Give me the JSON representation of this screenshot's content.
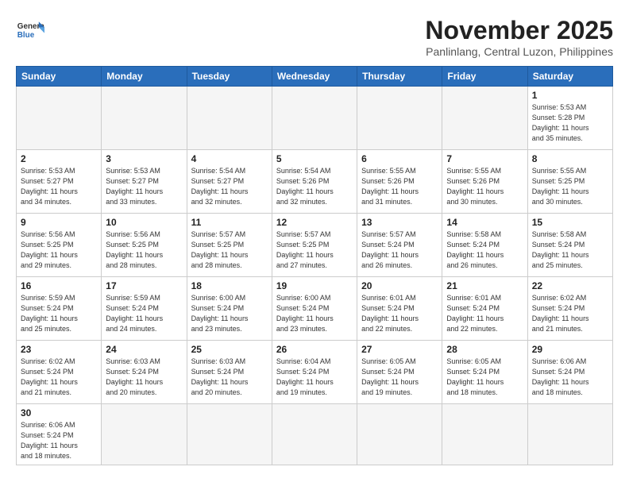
{
  "header": {
    "logo_text_general": "General",
    "logo_text_blue": "Blue",
    "month_title": "November 2025",
    "location": "Panlinlang, Central Luzon, Philippines"
  },
  "weekdays": [
    "Sunday",
    "Monday",
    "Tuesday",
    "Wednesday",
    "Thursday",
    "Friday",
    "Saturday"
  ],
  "weeks": [
    [
      {
        "day": null,
        "info": ""
      },
      {
        "day": null,
        "info": ""
      },
      {
        "day": null,
        "info": ""
      },
      {
        "day": null,
        "info": ""
      },
      {
        "day": null,
        "info": ""
      },
      {
        "day": null,
        "info": ""
      },
      {
        "day": "1",
        "info": "Sunrise: 5:53 AM\nSunset: 5:28 PM\nDaylight: 11 hours\nand 35 minutes."
      }
    ],
    [
      {
        "day": "2",
        "info": "Sunrise: 5:53 AM\nSunset: 5:27 PM\nDaylight: 11 hours\nand 34 minutes."
      },
      {
        "day": "3",
        "info": "Sunrise: 5:53 AM\nSunset: 5:27 PM\nDaylight: 11 hours\nand 33 minutes."
      },
      {
        "day": "4",
        "info": "Sunrise: 5:54 AM\nSunset: 5:27 PM\nDaylight: 11 hours\nand 32 minutes."
      },
      {
        "day": "5",
        "info": "Sunrise: 5:54 AM\nSunset: 5:26 PM\nDaylight: 11 hours\nand 32 minutes."
      },
      {
        "day": "6",
        "info": "Sunrise: 5:55 AM\nSunset: 5:26 PM\nDaylight: 11 hours\nand 31 minutes."
      },
      {
        "day": "7",
        "info": "Sunrise: 5:55 AM\nSunset: 5:26 PM\nDaylight: 11 hours\nand 30 minutes."
      },
      {
        "day": "8",
        "info": "Sunrise: 5:55 AM\nSunset: 5:25 PM\nDaylight: 11 hours\nand 30 minutes."
      }
    ],
    [
      {
        "day": "9",
        "info": "Sunrise: 5:56 AM\nSunset: 5:25 PM\nDaylight: 11 hours\nand 29 minutes."
      },
      {
        "day": "10",
        "info": "Sunrise: 5:56 AM\nSunset: 5:25 PM\nDaylight: 11 hours\nand 28 minutes."
      },
      {
        "day": "11",
        "info": "Sunrise: 5:57 AM\nSunset: 5:25 PM\nDaylight: 11 hours\nand 28 minutes."
      },
      {
        "day": "12",
        "info": "Sunrise: 5:57 AM\nSunset: 5:25 PM\nDaylight: 11 hours\nand 27 minutes."
      },
      {
        "day": "13",
        "info": "Sunrise: 5:57 AM\nSunset: 5:24 PM\nDaylight: 11 hours\nand 26 minutes."
      },
      {
        "day": "14",
        "info": "Sunrise: 5:58 AM\nSunset: 5:24 PM\nDaylight: 11 hours\nand 26 minutes."
      },
      {
        "day": "15",
        "info": "Sunrise: 5:58 AM\nSunset: 5:24 PM\nDaylight: 11 hours\nand 25 minutes."
      }
    ],
    [
      {
        "day": "16",
        "info": "Sunrise: 5:59 AM\nSunset: 5:24 PM\nDaylight: 11 hours\nand 25 minutes."
      },
      {
        "day": "17",
        "info": "Sunrise: 5:59 AM\nSunset: 5:24 PM\nDaylight: 11 hours\nand 24 minutes."
      },
      {
        "day": "18",
        "info": "Sunrise: 6:00 AM\nSunset: 5:24 PM\nDaylight: 11 hours\nand 23 minutes."
      },
      {
        "day": "19",
        "info": "Sunrise: 6:00 AM\nSunset: 5:24 PM\nDaylight: 11 hours\nand 23 minutes."
      },
      {
        "day": "20",
        "info": "Sunrise: 6:01 AM\nSunset: 5:24 PM\nDaylight: 11 hours\nand 22 minutes."
      },
      {
        "day": "21",
        "info": "Sunrise: 6:01 AM\nSunset: 5:24 PM\nDaylight: 11 hours\nand 22 minutes."
      },
      {
        "day": "22",
        "info": "Sunrise: 6:02 AM\nSunset: 5:24 PM\nDaylight: 11 hours\nand 21 minutes."
      }
    ],
    [
      {
        "day": "23",
        "info": "Sunrise: 6:02 AM\nSunset: 5:24 PM\nDaylight: 11 hours\nand 21 minutes."
      },
      {
        "day": "24",
        "info": "Sunrise: 6:03 AM\nSunset: 5:24 PM\nDaylight: 11 hours\nand 20 minutes."
      },
      {
        "day": "25",
        "info": "Sunrise: 6:03 AM\nSunset: 5:24 PM\nDaylight: 11 hours\nand 20 minutes."
      },
      {
        "day": "26",
        "info": "Sunrise: 6:04 AM\nSunset: 5:24 PM\nDaylight: 11 hours\nand 19 minutes."
      },
      {
        "day": "27",
        "info": "Sunrise: 6:05 AM\nSunset: 5:24 PM\nDaylight: 11 hours\nand 19 minutes."
      },
      {
        "day": "28",
        "info": "Sunrise: 6:05 AM\nSunset: 5:24 PM\nDaylight: 11 hours\nand 18 minutes."
      },
      {
        "day": "29",
        "info": "Sunrise: 6:06 AM\nSunset: 5:24 PM\nDaylight: 11 hours\nand 18 minutes."
      }
    ],
    [
      {
        "day": "30",
        "info": "Sunrise: 6:06 AM\nSunset: 5:24 PM\nDaylight: 11 hours\nand 18 minutes."
      },
      {
        "day": null,
        "info": ""
      },
      {
        "day": null,
        "info": ""
      },
      {
        "day": null,
        "info": ""
      },
      {
        "day": null,
        "info": ""
      },
      {
        "day": null,
        "info": ""
      },
      {
        "day": null,
        "info": ""
      }
    ]
  ]
}
